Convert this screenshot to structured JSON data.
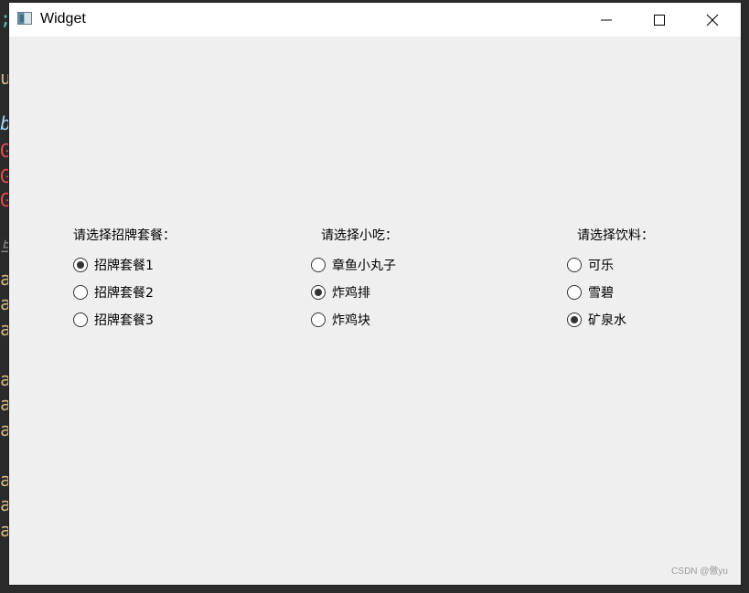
{
  "window": {
    "title": "Widget"
  },
  "groups": [
    {
      "label": "请选择招牌套餐：",
      "options": [
        {
          "label": "招牌套餐1",
          "checked": true
        },
        {
          "label": "招牌套餐2",
          "checked": false
        },
        {
          "label": "招牌套餐3",
          "checked": false
        }
      ]
    },
    {
      "label": "请选择小吃：",
      "options": [
        {
          "label": "章鱼小丸子",
          "checked": false
        },
        {
          "label": "炸鸡排",
          "checked": true
        },
        {
          "label": "炸鸡块",
          "checked": false
        }
      ]
    },
    {
      "label": "请选择饮料：",
      "options": [
        {
          "label": "可乐",
          "checked": false
        },
        {
          "label": "雪碧",
          "checked": false
        },
        {
          "label": "矿泉水",
          "checked": true
        }
      ]
    }
  ],
  "watermark": "CSDN @傲yu"
}
